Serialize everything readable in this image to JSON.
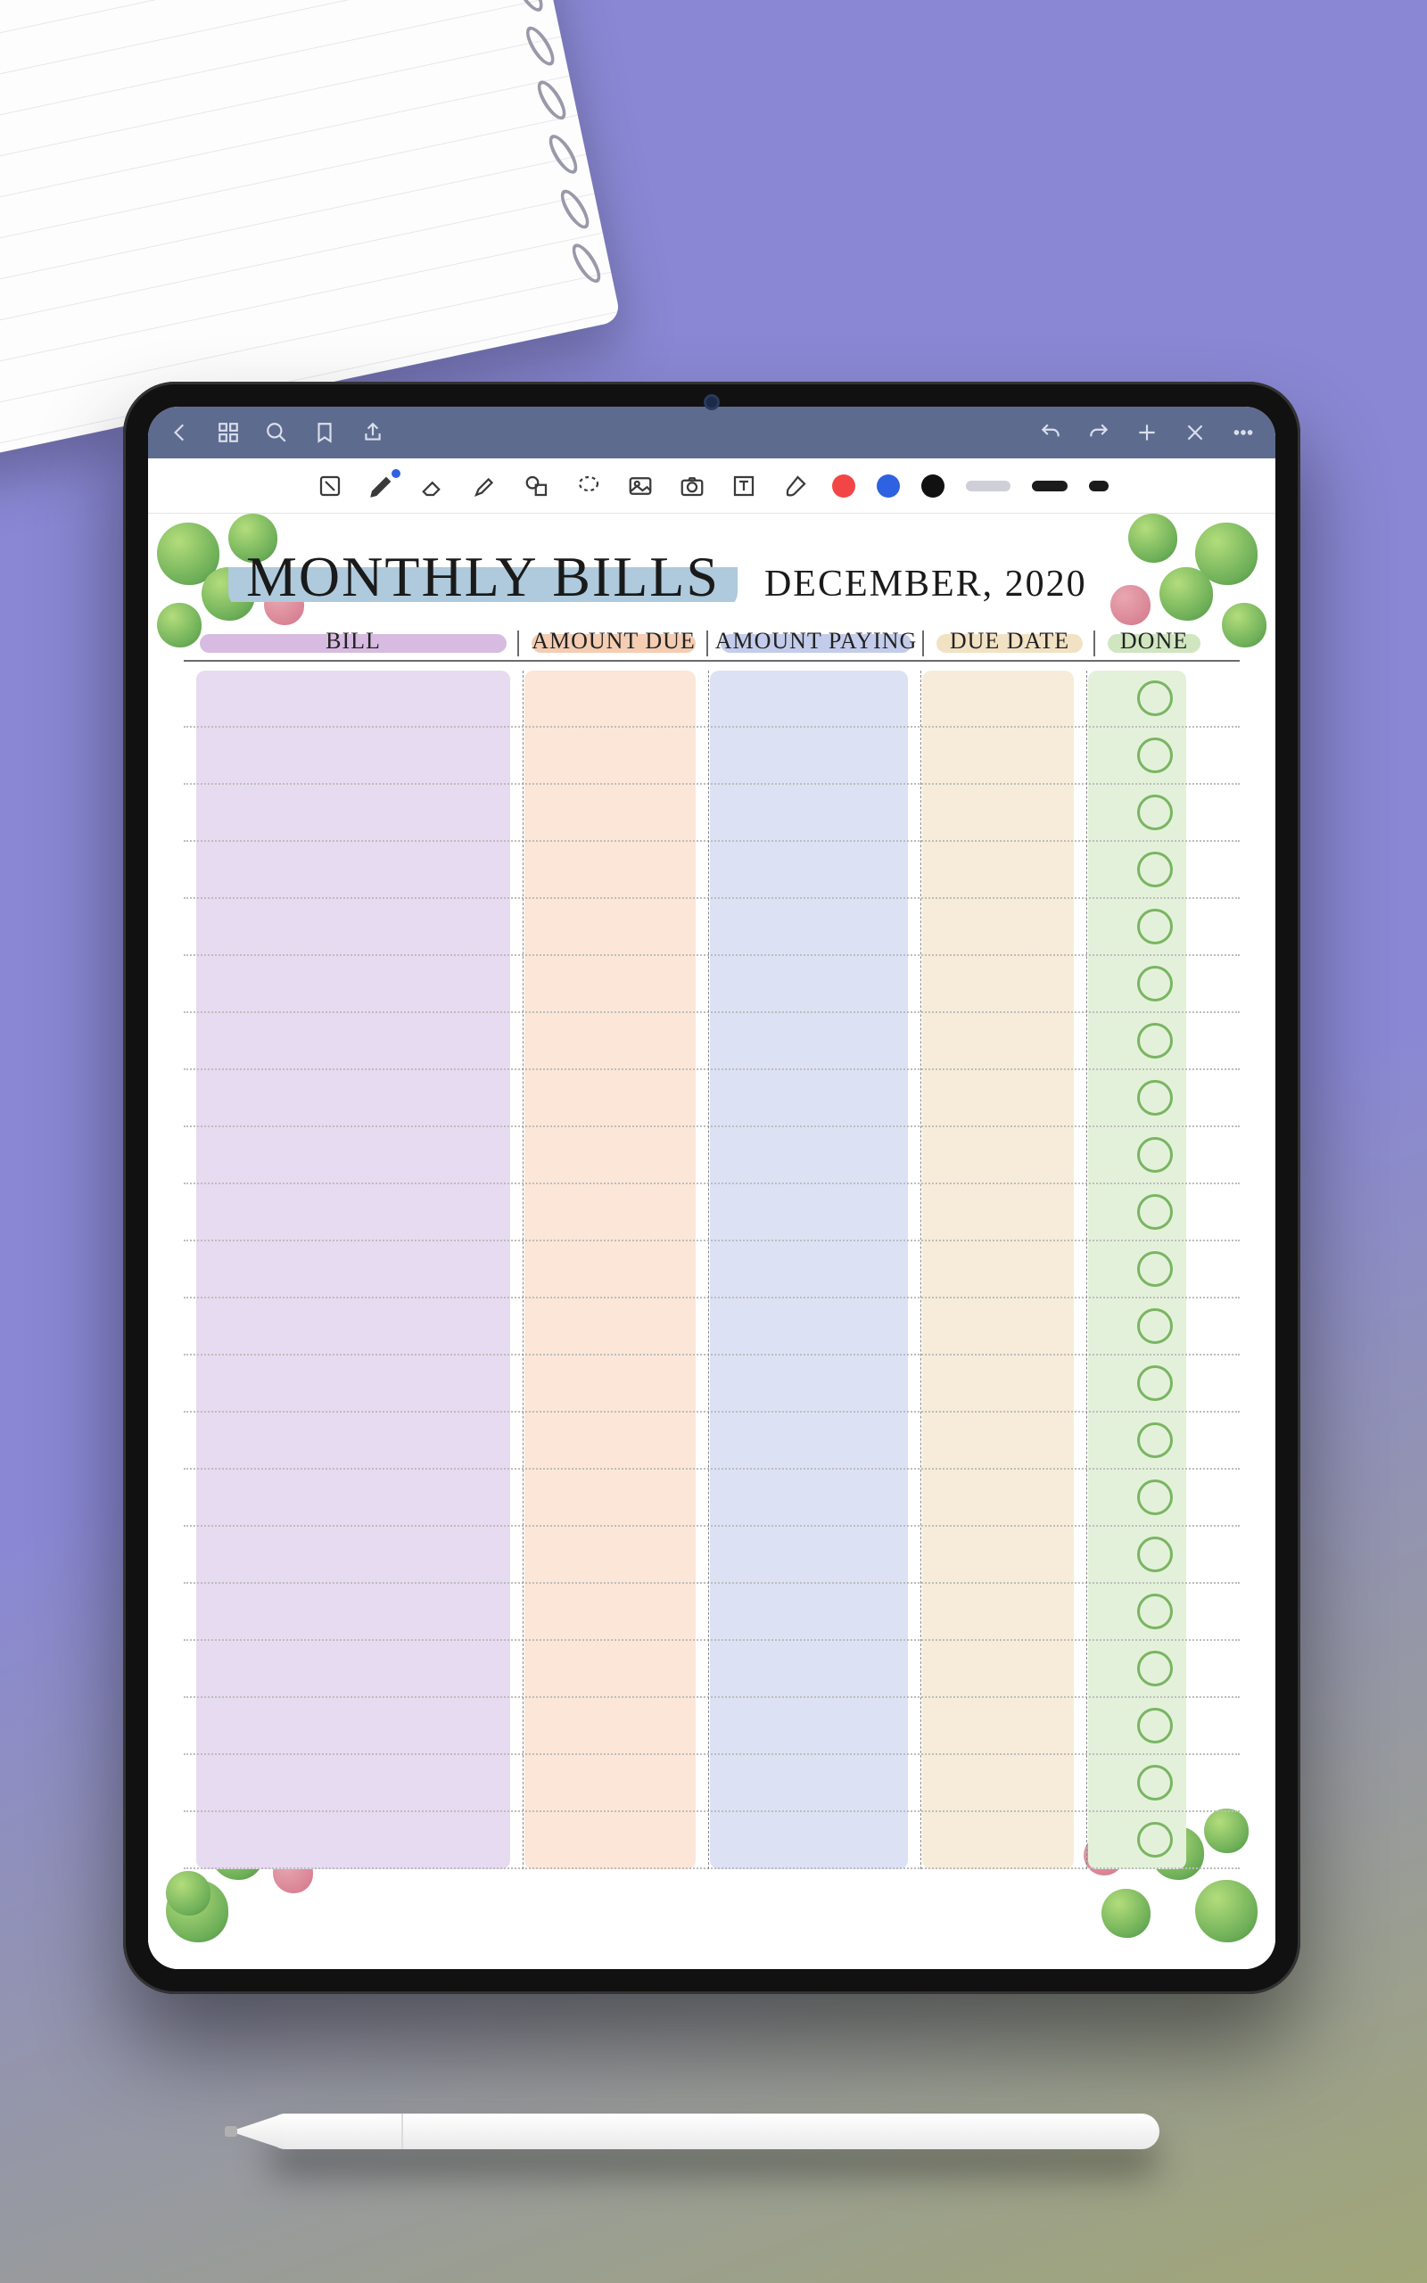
{
  "page": {
    "title": "MONTHLY BILLS",
    "subtitle": "DECEMBER, 2020"
  },
  "columns": {
    "bill": "BILL",
    "amount_due": "AMOUNT DUE",
    "amount_paying": "AMOUNT PAYING",
    "due_date": "DUE DATE",
    "done": "DONE"
  },
  "rows": [
    {
      "bill": "",
      "amount_due": "",
      "amount_paying": "",
      "due_date": "",
      "done": false
    },
    {
      "bill": "",
      "amount_due": "",
      "amount_paying": "",
      "due_date": "",
      "done": false
    },
    {
      "bill": "",
      "amount_due": "",
      "amount_paying": "",
      "due_date": "",
      "done": false
    },
    {
      "bill": "",
      "amount_due": "",
      "amount_paying": "",
      "due_date": "",
      "done": false
    },
    {
      "bill": "",
      "amount_due": "",
      "amount_paying": "",
      "due_date": "",
      "done": false
    },
    {
      "bill": "",
      "amount_due": "",
      "amount_paying": "",
      "due_date": "",
      "done": false
    },
    {
      "bill": "",
      "amount_due": "",
      "amount_paying": "",
      "due_date": "",
      "done": false
    },
    {
      "bill": "",
      "amount_due": "",
      "amount_paying": "",
      "due_date": "",
      "done": false
    },
    {
      "bill": "",
      "amount_due": "",
      "amount_paying": "",
      "due_date": "",
      "done": false
    },
    {
      "bill": "",
      "amount_due": "",
      "amount_paying": "",
      "due_date": "",
      "done": false
    },
    {
      "bill": "",
      "amount_due": "",
      "amount_paying": "",
      "due_date": "",
      "done": false
    },
    {
      "bill": "",
      "amount_due": "",
      "amount_paying": "",
      "due_date": "",
      "done": false
    },
    {
      "bill": "",
      "amount_due": "",
      "amount_paying": "",
      "due_date": "",
      "done": false
    },
    {
      "bill": "",
      "amount_due": "",
      "amount_paying": "",
      "due_date": "",
      "done": false
    },
    {
      "bill": "",
      "amount_due": "",
      "amount_paying": "",
      "due_date": "",
      "done": false
    },
    {
      "bill": "",
      "amount_due": "",
      "amount_paying": "",
      "due_date": "",
      "done": false
    },
    {
      "bill": "",
      "amount_due": "",
      "amount_paying": "",
      "due_date": "",
      "done": false
    },
    {
      "bill": "",
      "amount_due": "",
      "amount_paying": "",
      "due_date": "",
      "done": false
    },
    {
      "bill": "",
      "amount_due": "",
      "amount_paying": "",
      "due_date": "",
      "done": false
    },
    {
      "bill": "",
      "amount_due": "",
      "amount_paying": "",
      "due_date": "",
      "done": false
    },
    {
      "bill": "",
      "amount_due": "",
      "amount_paying": "",
      "due_date": "",
      "done": false
    }
  ],
  "colors": {
    "bill": "#e6dbf0",
    "amount_due": "#fbe6d8",
    "amount_paying": "#dde1f4",
    "due_date": "#f6ecd9",
    "done": "#e4f1da",
    "swatch_red": "#f24646",
    "swatch_blue": "#2f62e0",
    "swatch_black": "#111111"
  }
}
